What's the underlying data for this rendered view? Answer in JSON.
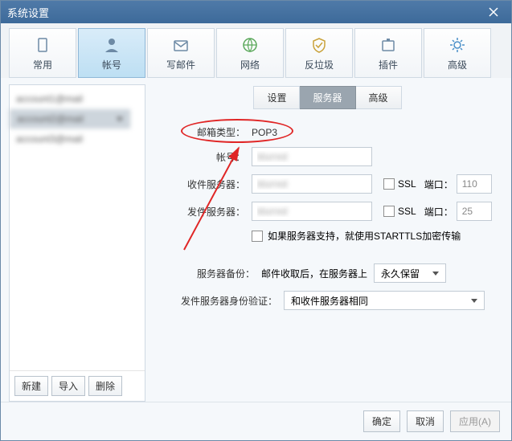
{
  "title": "系统设置",
  "top_tabs": [
    {
      "label": "常用"
    },
    {
      "label": "帐号"
    },
    {
      "label": "写邮件"
    },
    {
      "label": "网络"
    },
    {
      "label": "反垃圾"
    },
    {
      "label": "插件"
    },
    {
      "label": "高级"
    }
  ],
  "accounts": [
    "account1@mail",
    "account2@mail",
    "account3@mail"
  ],
  "side_buttons": {
    "new": "新建",
    "import": "导入",
    "delete": "删除"
  },
  "sub_tabs": {
    "settings": "设置",
    "server": "服务器",
    "adv": "高级"
  },
  "form": {
    "mailbox_type_label": "邮箱类型：",
    "mailbox_type_value": "POP3",
    "account_label": "帐号：",
    "account_value": "blurred",
    "incoming_label": "收件服务器：",
    "incoming_value": "blurred",
    "outgoing_label": "发件服务器：",
    "outgoing_value": "blurred",
    "ssl_label": "SSL",
    "port_label": "端口：",
    "port_in": "110",
    "port_out": "25",
    "starttls": "如果服务器支持，就使用STARTTLS加密传输",
    "backup_label": "服务器备份：",
    "backup_text": "邮件收取后，在服务器上",
    "backup_select": "永久保留",
    "auth_label": "发件服务器身份验证：",
    "auth_select": "和收件服务器相同"
  },
  "footer": {
    "ok": "确定",
    "cancel": "取消",
    "apply": "应用(A)"
  }
}
